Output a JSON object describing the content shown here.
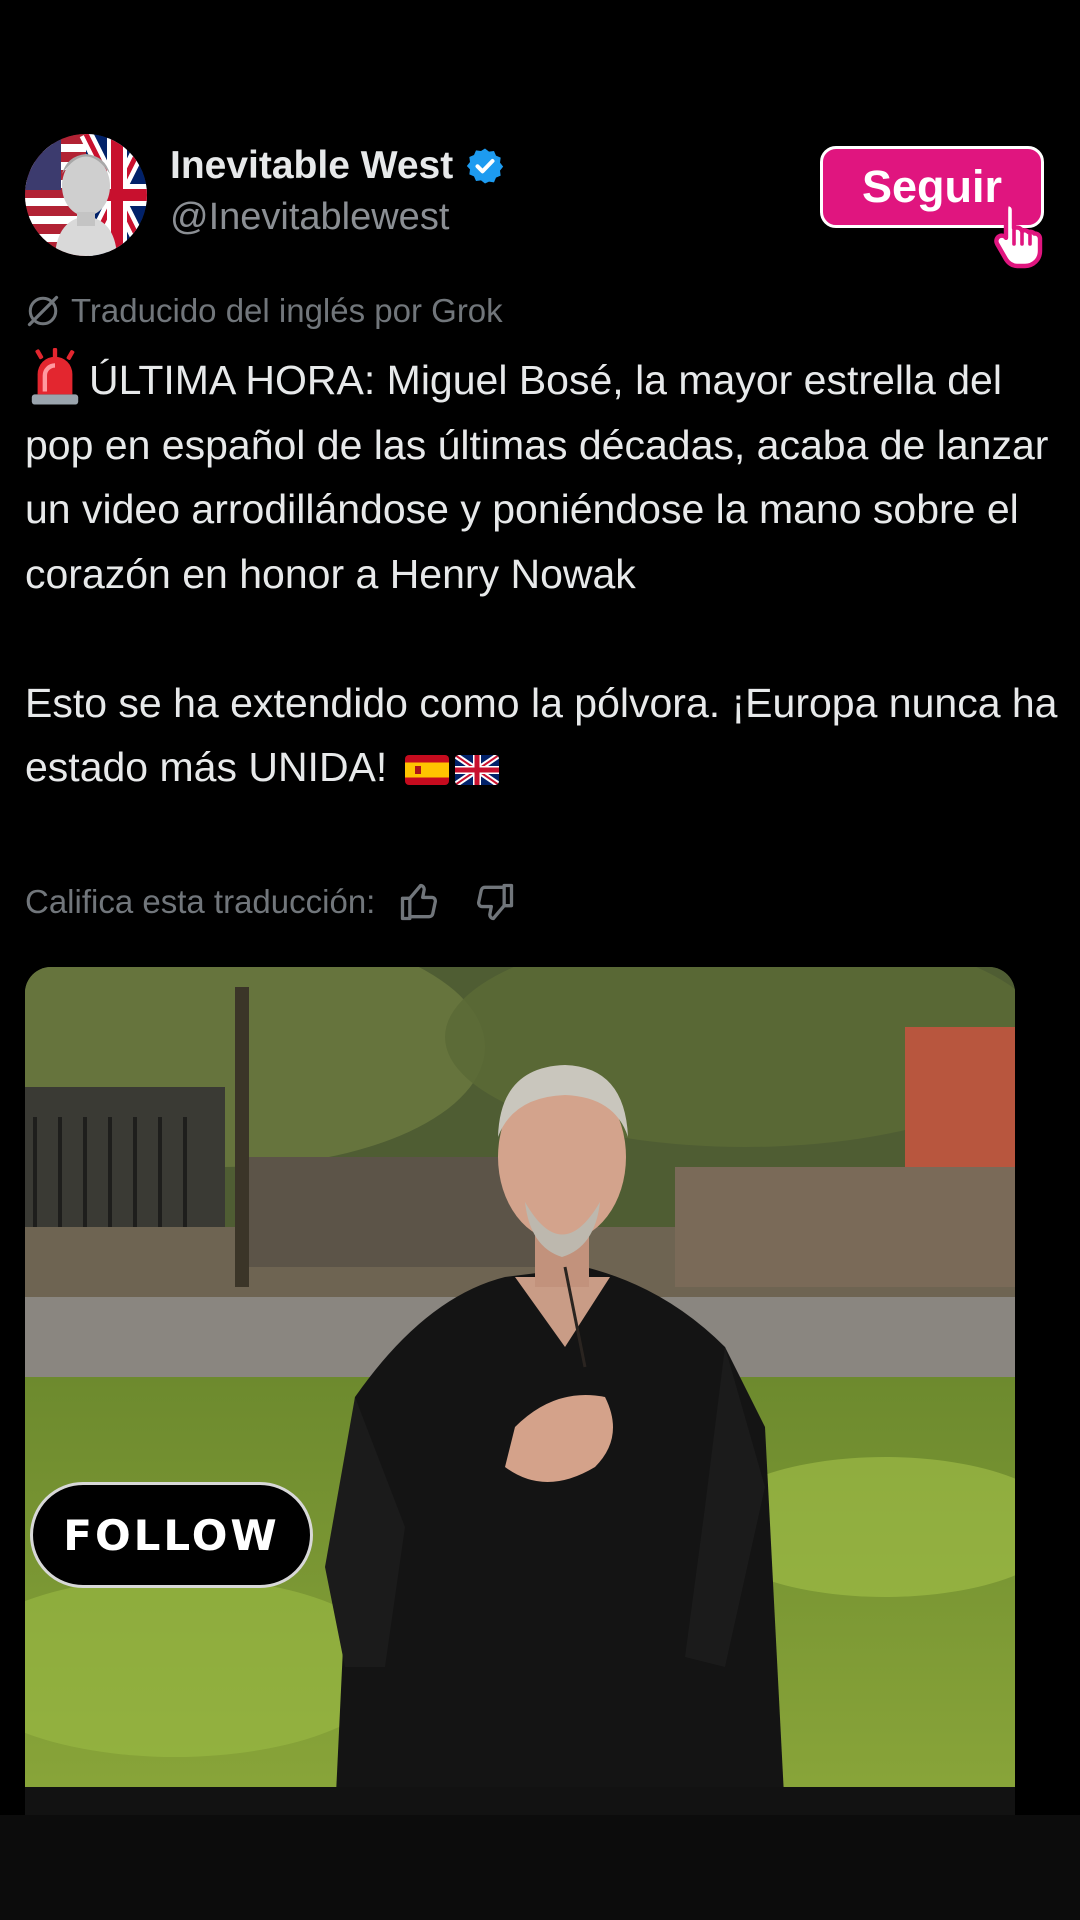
{
  "post": {
    "author": {
      "name": "Inevitable West",
      "handle": "@Inevitablewest",
      "verified": true,
      "avatar_icon": "statue-avatar"
    },
    "follow_button_label": "Seguir",
    "translation_note": "Traducido del inglés por Grok",
    "text_lines": {
      "para1": "ÚLTIMA HORA: Miguel Bosé, la mayor estrella del pop en español de las últimas décadas, acaba de lanzar un video arrodillándose y poniéndose la mano sobre el corazón en honor a Henry Nowak",
      "para2": "Esto se ha extendido como la pólvora. ¡Europa nunca ha estado más UNIDA!"
    },
    "emojis": [
      "police-siren-emoji",
      "spain-flag-emoji",
      "uk-flag-emoji"
    ],
    "rate_label": "Califica esta traducción:",
    "media": {
      "sticker_label": "FOLLOW"
    }
  },
  "colors": {
    "background": "#000000",
    "text": "#e7e9ea",
    "muted": "#71767b",
    "follow_button": "#e0157f",
    "verified": "#1d9bf0"
  }
}
